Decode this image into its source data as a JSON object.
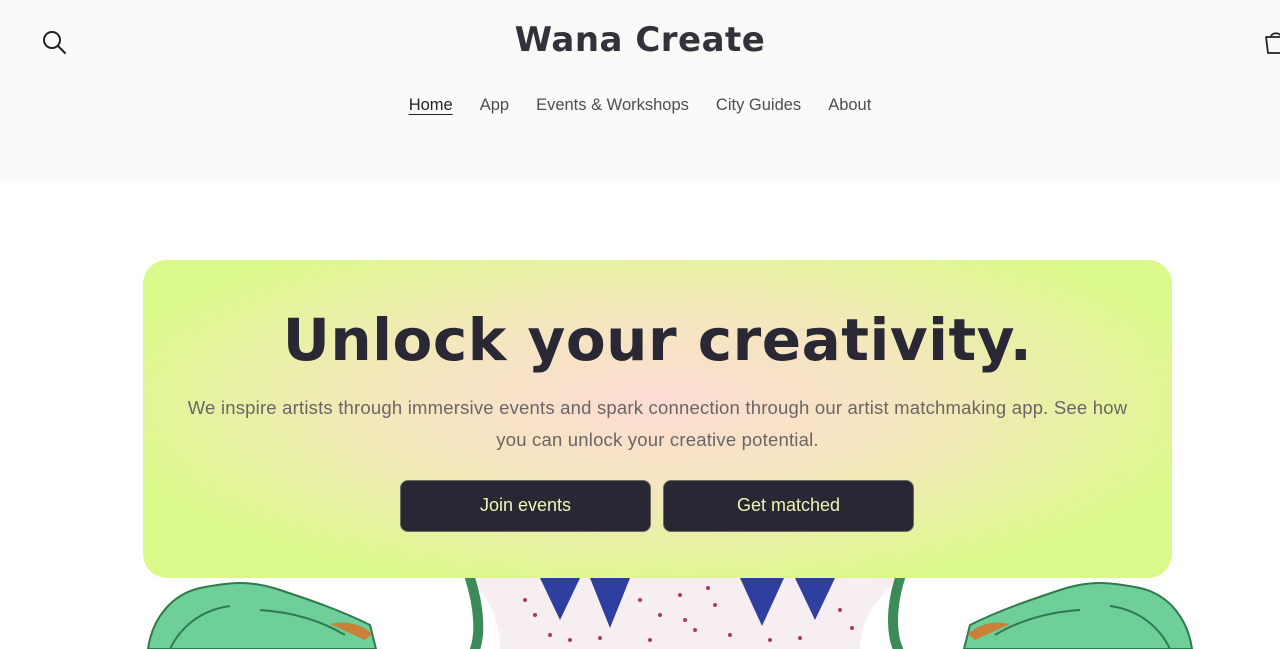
{
  "header": {
    "brand": "Wana Create",
    "search_icon": "search-icon",
    "cart_icon": "cart-icon"
  },
  "nav": {
    "items": [
      {
        "label": "Home",
        "active": true
      },
      {
        "label": "App"
      },
      {
        "label": "Events & Workshops"
      },
      {
        "label": "City Guides"
      },
      {
        "label": "About"
      }
    ]
  },
  "hero": {
    "title": "Unlock your creativity.",
    "subtitle": "We inspire artists through immersive events and spark connection through our artist matchmaking app. See how you can unlock your creative potential.",
    "buttons": [
      {
        "label": "Join events"
      },
      {
        "label": "Get matched"
      }
    ]
  },
  "colors": {
    "header_bg": "#fbfaf8",
    "hero_green": "#dbf98a",
    "hero_pink": "#fcdcd4",
    "button_bg": "#2a2735",
    "button_text": "#f0f5b5",
    "title_text": "#2a2835"
  }
}
